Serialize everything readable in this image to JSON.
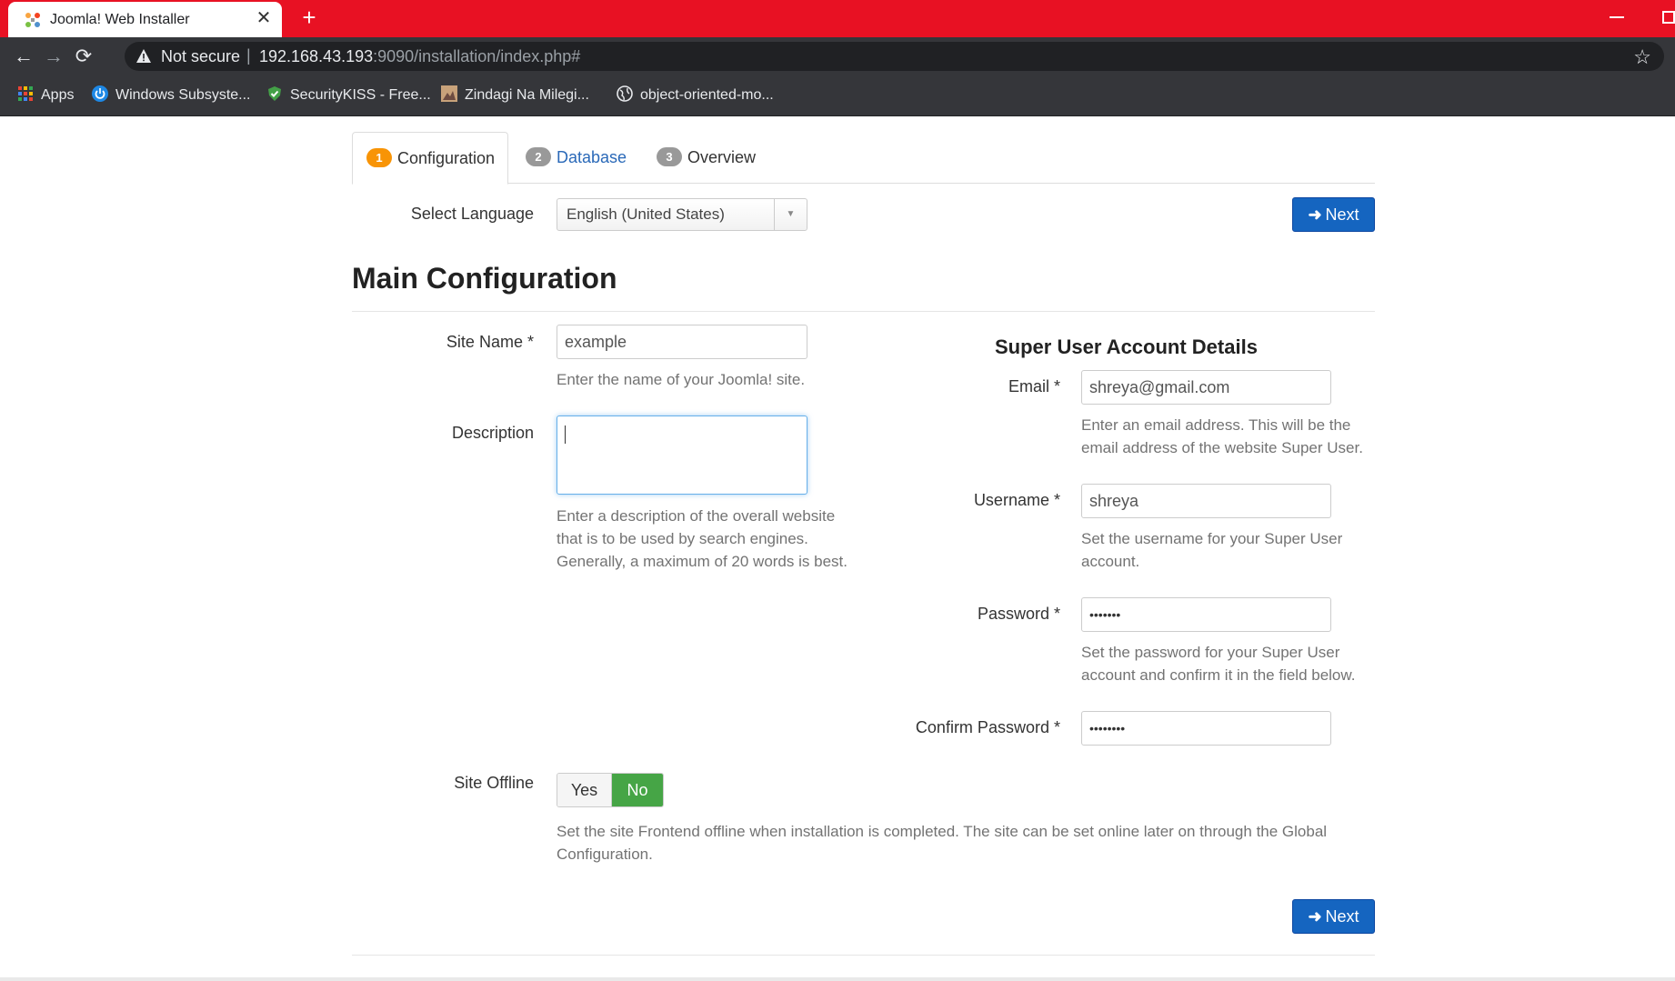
{
  "browser": {
    "tab_title": "Joomla! Web Installer",
    "tab_close": "✕",
    "new_tab": "+",
    "security_label": "Not secure",
    "url_sep": "|",
    "url_host": "192.168.43.193",
    "url_path": ":9090/installation/index.php#",
    "bookmarks": [
      {
        "label": "Apps",
        "icon": "apps-grid-icon"
      },
      {
        "label": "Windows Subsyste...",
        "icon": "power-icon"
      },
      {
        "label": "SecurityKISS - Free...",
        "icon": "shield-check-icon"
      },
      {
        "label": "Zindagi Na Milegi...",
        "icon": "image-icon"
      },
      {
        "label": "object-oriented-mo...",
        "icon": "globe-icon"
      }
    ]
  },
  "steps": [
    {
      "number": "1",
      "label": "Configuration",
      "state": "active"
    },
    {
      "number": "2",
      "label": "Database",
      "state": "link"
    },
    {
      "number": "3",
      "label": "Overview",
      "state": "plain"
    }
  ],
  "language": {
    "label": "Select Language",
    "value": "English (United States)"
  },
  "buttons": {
    "next_label": "Next",
    "next_arrow": "➜"
  },
  "main": {
    "title": "Main Configuration",
    "site_name": {
      "label": "Site Name",
      "required": "*",
      "value": "example",
      "help": "Enter the name of your Joomla! site."
    },
    "description": {
      "label": "Description",
      "value": "",
      "help": "Enter a description of the overall website that is to be used by search engines. Generally, a maximum of 20 words is best."
    },
    "site_offline": {
      "label": "Site Offline",
      "yes": "Yes",
      "no": "No",
      "selected": "No",
      "help": "Set the site Frontend offline when installation is completed. The site can be set online later on through the Global Configuration."
    }
  },
  "super_user": {
    "title": "Super User Account Details",
    "email": {
      "label": "Email",
      "required": "*",
      "value": "shreya@gmail.com",
      "help": "Enter an email address. This will be the email address of the website Super User."
    },
    "username": {
      "label": "Username",
      "required": "*",
      "value": "shreya",
      "help": "Set the username for your Super User account."
    },
    "password": {
      "label": "Password",
      "required": "*",
      "value": "•••••••",
      "help": "Set the password for your Super User account and confirm it in the field below."
    },
    "confirm_password": {
      "label": "Confirm Password",
      "required": "*",
      "value": "••••••••"
    }
  },
  "colors": {
    "chrome_red": "#e81123",
    "primary_button": "#1565c0",
    "toggle_active": "#46a546",
    "step_badge_active": "#f89406"
  }
}
